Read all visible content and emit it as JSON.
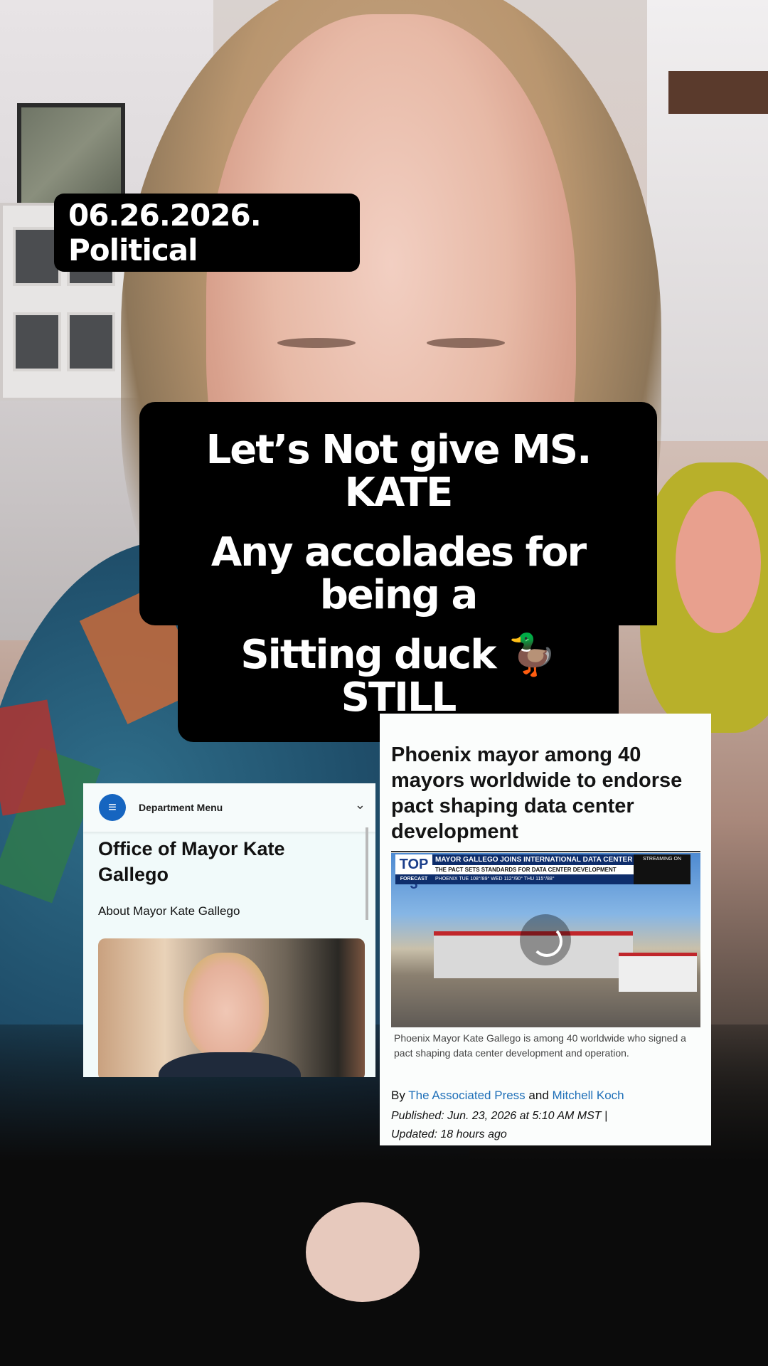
{
  "overlay": {
    "date_tag": "06.26.2026. Political",
    "caption_lines": [
      "Let’s Not give MS. KATE",
      "Any accolades for being a",
      "Sitting duck 🦆 STILL"
    ]
  },
  "city_card": {
    "menu_label": "Department Menu",
    "title": "Office of Mayor Kate Gallego",
    "about_link": "About Mayor Kate Gallego"
  },
  "news_card": {
    "headline": "Phoenix mayor among 40 mayors worldwide to endorse pact shaping data center development",
    "video": {
      "badge_top": "TOP 3",
      "badge_bottom": "FORECAST",
      "banner_title": "MAYOR GALLEGO JOINS INTERNATIONAL DATA CENTER PACT",
      "banner_subtitle": "THE PACT SETS STANDARDS FOR DATA CENTER DEVELOPMENT",
      "forecast_strip": "PHOENIX   TUE 108°/89°   WED 112°/90°   THU 115°/88°",
      "stream_label": "STREAMING ON"
    },
    "caption": "Phoenix Mayor Kate Gallego is among 40 worldwide who signed a pact shaping data center development and operation.",
    "byline_prefix": "By",
    "author_1": "The Associated Press",
    "byline_join": "and",
    "author_2": "Mitchell Koch",
    "published": "Published: Jun. 23, 2026 at 5:10 AM MST",
    "updated": "Updated: 18 hours ago"
  }
}
